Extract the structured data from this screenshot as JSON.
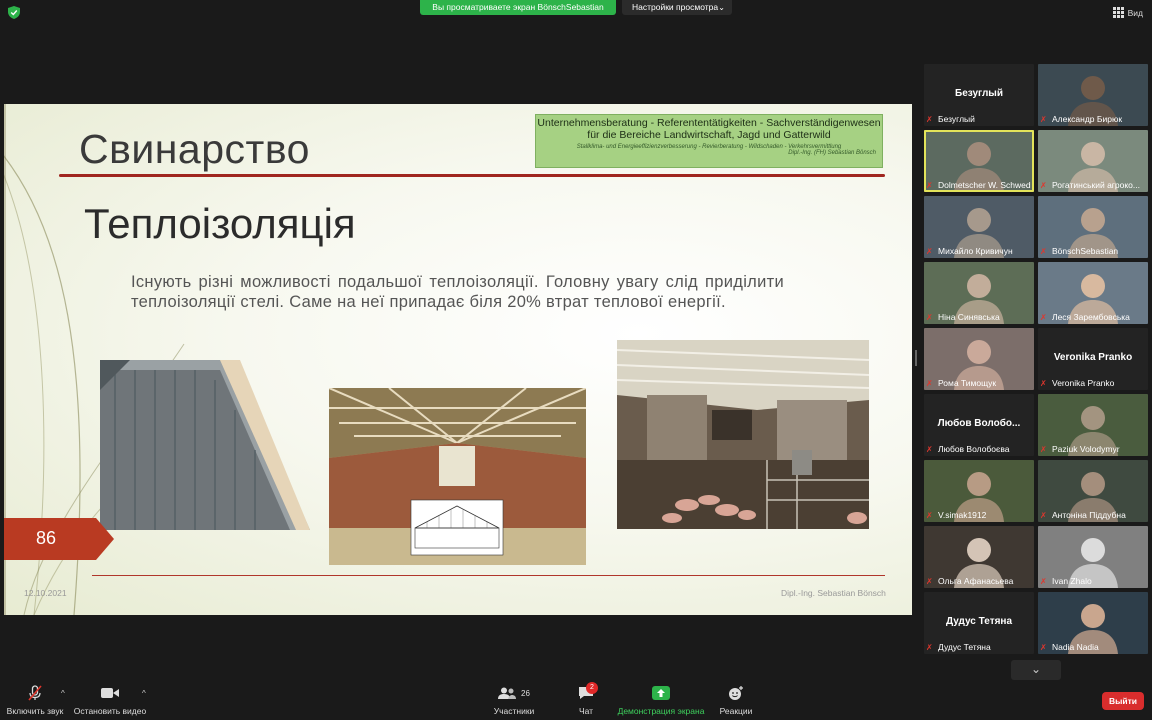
{
  "top": {
    "share_banner": "Вы просматриваете экран BönschSebastian",
    "view_options": "Настройки просмотра",
    "view_button": "Вид"
  },
  "slide": {
    "title": "Свинарство",
    "subtitle": "Теплоізоляція",
    "body": "Існують різні можливості подальшої теплоізоляції. Головну увагу слід приділити теплоізоляції стелі. Саме на неї припадає біля 20% втрат теплової енергії.",
    "logo": {
      "line1": "Unternehmensberatung - Referententätigkeiten - Sachverständigenwesen",
      "line2": "für die Bereiche Landwirtschaft, Jagd und Gatterwild",
      "line3": "Stallklima- und Energieeffizienzverbesserung - Revierberatung - Wildschaden - Verkehrsvermittlung",
      "line4": "Dipl.-Ing. (FH) Sebastian Bönsch"
    },
    "page_number": "86",
    "date": "12.10.2021",
    "author": "Dipl.-Ing. Sebastian Bönsch"
  },
  "participants": [
    {
      "name": "Безуглый",
      "big": "Безуглый",
      "video": false
    },
    {
      "name": "Александр Бирюк",
      "video": true
    },
    {
      "name": "Dolmetscher W. Schwed",
      "video": true,
      "active": true
    },
    {
      "name": "Рогатинський агроко...",
      "video": true
    },
    {
      "name": "Михайло Кривичун",
      "video": true
    },
    {
      "name": "BönschSebastian",
      "video": true,
      "muted": false
    },
    {
      "name": "Ніна Синявська",
      "video": true
    },
    {
      "name": "Леся Зарембовська",
      "video": true
    },
    {
      "name": "Рома Тимощук",
      "video": true
    },
    {
      "name": "Veronika Pranko",
      "big": "Veronika Pranko",
      "video": false
    },
    {
      "name": "Любов Волобоєва",
      "big": "Любов Волобо...",
      "video": false
    },
    {
      "name": "Paziuk Volodymyr",
      "video": true
    },
    {
      "name": "V.simak1912",
      "video": true
    },
    {
      "name": "Антоніна Піддубна",
      "video": true
    },
    {
      "name": "Ольга Афанасьева",
      "video": true
    },
    {
      "name": "Ivan Zhalo",
      "video": true
    },
    {
      "name": "Дудус Тетяна",
      "big": "Дудус Тетяна",
      "video": false
    },
    {
      "name": "Nadia Nadia",
      "video": true
    }
  ],
  "toolbar": {
    "mute": "Включить звук",
    "video": "Остановить видео",
    "participants": "Участники",
    "participants_count": "26",
    "chat": "Чат",
    "chat_badge": "2",
    "share": "Демонстрация экрана",
    "reactions": "Реакции",
    "leave": "Выйти"
  },
  "colors": {
    "share_green": "#2db34a",
    "leave_red": "#d92d2d",
    "slide_accent": "#a0261f",
    "logo_green": "#a6d183",
    "active_speaker": "#e3e35a"
  }
}
